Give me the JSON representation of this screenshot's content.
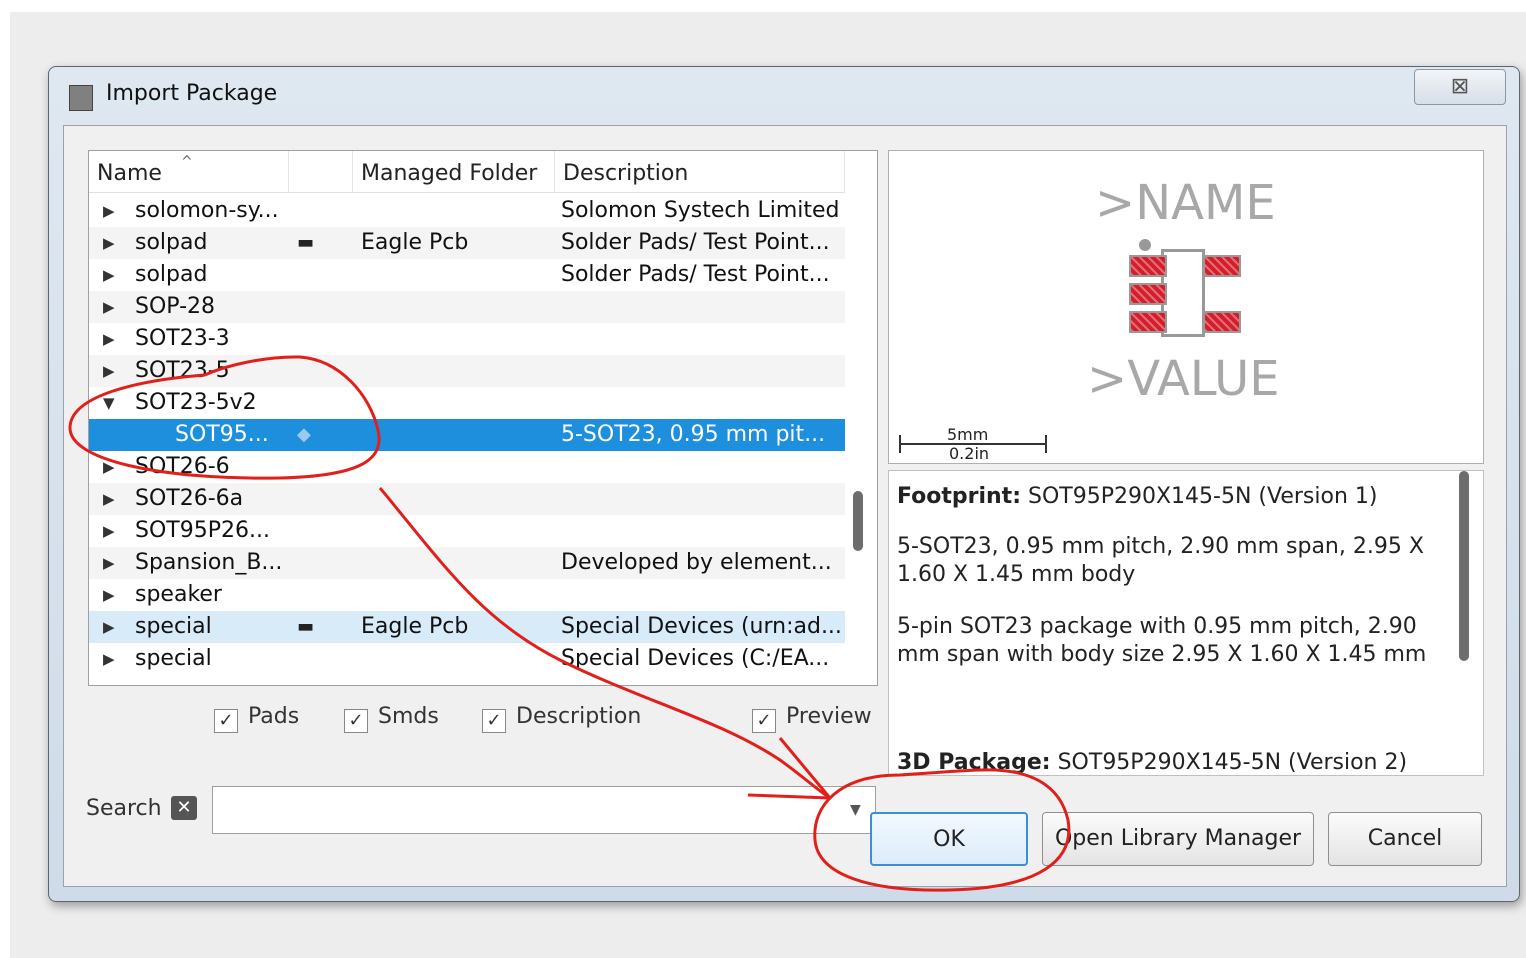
{
  "dialog": {
    "title": "Import Package",
    "close_glyph": "⊠"
  },
  "tree": {
    "columns": [
      "Name",
      "",
      "Managed Folder",
      "Description"
    ],
    "rows": [
      {
        "expander": "▶",
        "name": "solomon-sy...",
        "lock": "",
        "folder": "",
        "desc": "Solomon Systech Limited"
      },
      {
        "expander": "▶",
        "name": "solpad",
        "lock": "▬",
        "folder": "Eagle Pcb",
        "desc": "Solder Pads/ Test Point..."
      },
      {
        "expander": "▶",
        "name": "solpad",
        "lock": "",
        "folder": "",
        "desc": "Solder Pads/ Test Point..."
      },
      {
        "expander": "▶",
        "name": "SOP-28",
        "lock": "",
        "folder": "",
        "desc": ""
      },
      {
        "expander": "▶",
        "name": "SOT23-3",
        "lock": "",
        "folder": "",
        "desc": ""
      },
      {
        "expander": "▶",
        "name": "SOT23-5",
        "lock": "",
        "folder": "",
        "desc": ""
      },
      {
        "expander": "▼",
        "name": "SOT23-5v2",
        "lock": "",
        "folder": "",
        "desc": ""
      },
      {
        "expander": "",
        "name": "SOT95...",
        "lock": "◆",
        "folder": "",
        "desc": "5-SOT23, 0.95 mm pit..."
      },
      {
        "expander": "▶",
        "name": "SOT26-6",
        "lock": "",
        "folder": "",
        "desc": ""
      },
      {
        "expander": "▶",
        "name": "SOT26-6a",
        "lock": "",
        "folder": "",
        "desc": ""
      },
      {
        "expander": "▶",
        "name": "SOT95P26...",
        "lock": "",
        "folder": "",
        "desc": ""
      },
      {
        "expander": "▶",
        "name": "Spansion_B...",
        "lock": "",
        "folder": "",
        "desc": "Developed by element..."
      },
      {
        "expander": "▶",
        "name": "speaker",
        "lock": "",
        "folder": "",
        "desc": ""
      },
      {
        "expander": "▶",
        "name": "special",
        "lock": "▬",
        "folder": "Eagle Pcb",
        "desc": "Special Devices (urn:ad..."
      },
      {
        "expander": "▶",
        "name": "special",
        "lock": "",
        "folder": "",
        "desc": "Special Devices (C:/EA..."
      }
    ],
    "selected_index": 7,
    "highlight_index": 13
  },
  "filters": {
    "check": "✓",
    "pads": "Pads",
    "smds": "Smds",
    "description": "Description",
    "preview": "Preview"
  },
  "search": {
    "label": "Search",
    "clear_glyph": "✕",
    "value": "",
    "dropdown_glyph": "▼"
  },
  "preview": {
    "name_text": ">NAME",
    "value_text": ">VALUE",
    "scale_mm": "5mm",
    "scale_in": "0.2in"
  },
  "info": {
    "footprint_label": "Footprint:",
    "footprint_value": "SOT95P290X145-5N (Version 1)",
    "summary": "5-SOT23, 0.95 mm pitch, 2.90 mm span, 2.95 X 1.60 X 1.45 mm body",
    "detail": "5-pin SOT23 package with 0.95 mm pitch, 2.90 mm span with body size 2.95 X 1.60 X 1.45 mm",
    "package_label": "3D Package:",
    "package_value": "SOT95P290X145-5N (Version 2)"
  },
  "buttons": {
    "ok": "OK",
    "library_manager": "Open Library Manager",
    "cancel": "Cancel"
  },
  "colors": {
    "selection": "#1d8fdc",
    "annotation": "#e0201a",
    "pad": "#d41e2c"
  }
}
